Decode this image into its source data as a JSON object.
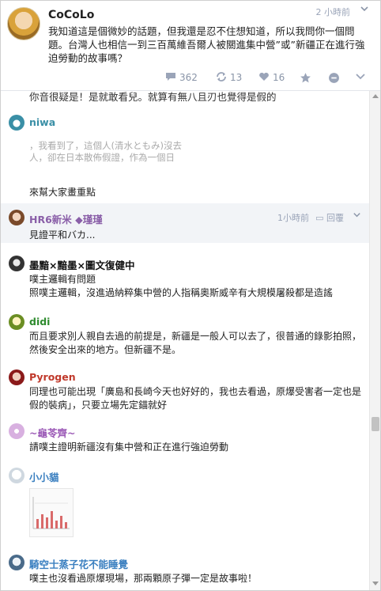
{
  "post": {
    "author": "CoCoLo",
    "time": "2 小時前",
    "text": "我知道這是個微妙的話題，但我還是忍不住想知道，所以我問你一個問題。台灣人也相信一到三百萬維吾爾人被關進集中營”或”新疆正在進行強迫勞動的故事嗎？",
    "stats": {
      "replies": "362",
      "reposts": "13",
      "likes": "16"
    }
  },
  "replies": {
    "cut_line": "你音很疑是！是就敢看兒。就算有無八且刃也覺得是假的",
    "niwa": {
      "name": "niwa",
      "image_text_1": "，我看到了，這個人(清水ともみ)沒去",
      "image_text_2": "人，卻在日本散佈假證，作為一個日",
      "text": "來幫大家畫重點"
    },
    "hr6": {
      "name": "HR6新米 ◆瑾瑾",
      "time": "1小時前",
      "reply_label": "回覆",
      "text": "見證平和バカ..."
    },
    "mo": {
      "name": "墨黯×黯墨×圖文復健中",
      "text_1": "噗主邏輯有問題",
      "text_2": "照噗主邏輯，沒進過納粹集中營的人指稱奧斯威辛有大規模屠殺都是造謠"
    },
    "didi": {
      "name": "didi",
      "text": "而且要求別人親自去過的前提是，新疆是一般人可以去了，很普通的錄影拍照，然後安全出來的地方。但新疆不是。"
    },
    "pyrogen": {
      "name": "Pyrogen",
      "text": "同理也可能出現「廣島和長崎今天也好好的，我也去看過，原爆受害者一定也是假的裝病」，只要立場先定錨就好"
    },
    "kame": {
      "name": "~龜苓齊~",
      "text": "請噗主證明新疆沒有集中營和正在進行強迫勞動"
    },
    "cat": {
      "name": "小小貓"
    },
    "knight": {
      "name": "騎空士蒸子花不能睡覺",
      "text": "噗主也沒看過原爆現場，那兩顆原子彈一定是故事啦！"
    }
  },
  "colors": {
    "niwa": "#3a8fa6",
    "hr6": "#8a5fa8",
    "didi": "#2e8b2e",
    "pyrogen": "#c0392b",
    "kame": "#9b59b6",
    "cat": "#3a7fc0",
    "knight": "#3a7fc0"
  }
}
